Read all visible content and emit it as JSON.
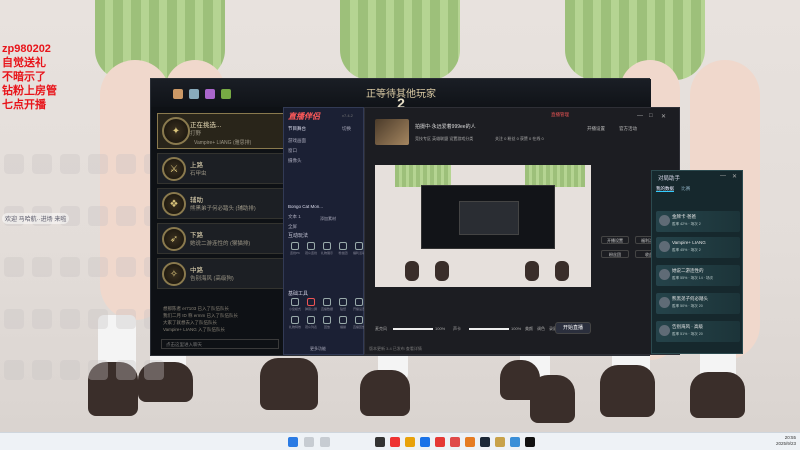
{
  "overlay_text": [
    "zp980202",
    "自觉送礼",
    "不暗示了",
    "钻粉上房管",
    "七点开播"
  ],
  "marquee": "欢迎 马哈航··进场 来啦",
  "lobby": {
    "title": "正等待其他玩家",
    "count": "2",
    "roles": [
      {
        "role": "打野",
        "status": "正在挑选...",
        "detail": "Vampire+ LIANG (雅思排)"
      },
      {
        "role": "上路",
        "status": "石甲虫"
      },
      {
        "role": "辅助",
        "status": "熊黑弟子何必踏头 (辅助排)"
      },
      {
        "role": "下路",
        "status": "她说二游连性的 (猴猫排)"
      },
      {
        "role": "中路",
        "status": "告别海风 (高级狗)"
      }
    ],
    "log": [
      "想那陈者 er7103 已入了队伍队长",
      "我们二月 ID 称 ermm 已入了队伍队长",
      "大家了就想去入了队伍队长",
      "Vampire+ LIANG 入了队伍队长"
    ],
    "chat_placeholder": "点击这里进入聊天"
  },
  "helper": {
    "logo": "直播伴侣",
    "version": "v7.4.2",
    "scene_label": "节目舞台",
    "switch_label": "切换",
    "add_label": "新增素材",
    "sources": [
      "游戏画面",
      "窗口",
      "摄像头",
      "Bongo Cat Mon...",
      "文本 1",
      "全屏"
    ],
    "add_source": "添加素材",
    "section1": "互动玩法",
    "tools1": [
      "连线PK",
      "观众连线",
      "礼物展示",
      "粉丝团",
      "福利活动"
    ],
    "section2": "基础工具",
    "tools2": [
      "小窗模式",
      "弹幕公屏",
      "直播数据",
      "贴纸",
      "开播设置",
      "礼物特效",
      "观众列表",
      "回放",
      "福袋",
      "直播回放"
    ],
    "more": "更多功能"
  },
  "stream": {
    "title": "拍摄中·永远爱着999ee的人",
    "tags": [
      "竞技专区",
      "英雄联盟",
      "设置游戏分类"
    ],
    "stats": [
      "关注 0",
      "粉丝 0",
      "获赞 0",
      "在线 0"
    ],
    "top": [
      "直播管理",
      "开播设置",
      "官方活动"
    ],
    "right_buttons": [
      "开播设置",
      "福利活动",
      "粉丝团",
      "收益"
    ],
    "controls": [
      "麦克风",
      "100%",
      "声卡",
      "100%",
      "美颜",
      "调色",
      "录屏"
    ],
    "go_live": "开始直播",
    "footer": "版本更新 3.4 已发布 查看详情"
  },
  "duiyou": {
    "title": "对局助手",
    "tabs": [
      "我的数据",
      "比赛"
    ],
    "cards": [
      {
        "name": "金牌卡·爸爸",
        "stats": "胜率 42% · 场次 2"
      },
      {
        "name": "Vampire+ LIANG",
        "stats": "胜率 45% · 场次 2"
      },
      {
        "name": "她说二游连性的",
        "stats": "胜率 55% · 场次 14 · 场次"
      },
      {
        "name": "熊黑弟子何必踏头",
        "stats": "胜率 50% · 场次 20"
      },
      {
        "name": "告别海风 · 高级",
        "stats": "胜率 51% · 场次 20"
      }
    ]
  },
  "clock": {
    "time": "20:55",
    "date": "2025/9/23"
  }
}
